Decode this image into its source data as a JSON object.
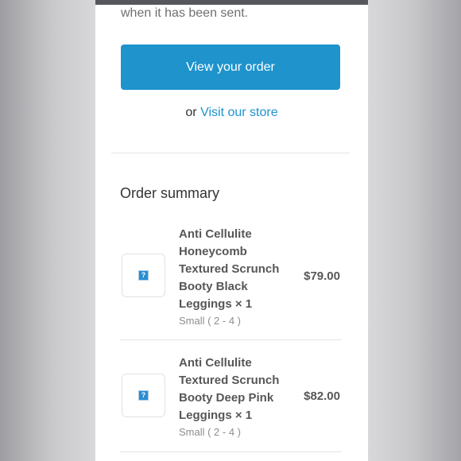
{
  "shipping_note": "when it has been sent.",
  "actions": {
    "view_order_label": "View your order",
    "or_text": "or",
    "visit_store_label": "Visit our store"
  },
  "order_summary": {
    "title": "Order summary",
    "items": [
      {
        "name": "Anti Cellulite Honeycomb Textured Scrunch Booty Black Leggings × 1",
        "variant": "Small ( 2 - 4 )",
        "price": "$79.00",
        "image": "broken-image-icon"
      },
      {
        "name": "Anti Cellulite Textured Scrunch Booty Deep Pink Leggings × 1",
        "variant": "Small ( 2 - 4 )",
        "price": "$82.00",
        "image": "broken-image-icon"
      }
    ]
  },
  "colors": {
    "accent": "#1e93cc",
    "product_text": "#575757",
    "variant_text": "#8e8e8e"
  }
}
